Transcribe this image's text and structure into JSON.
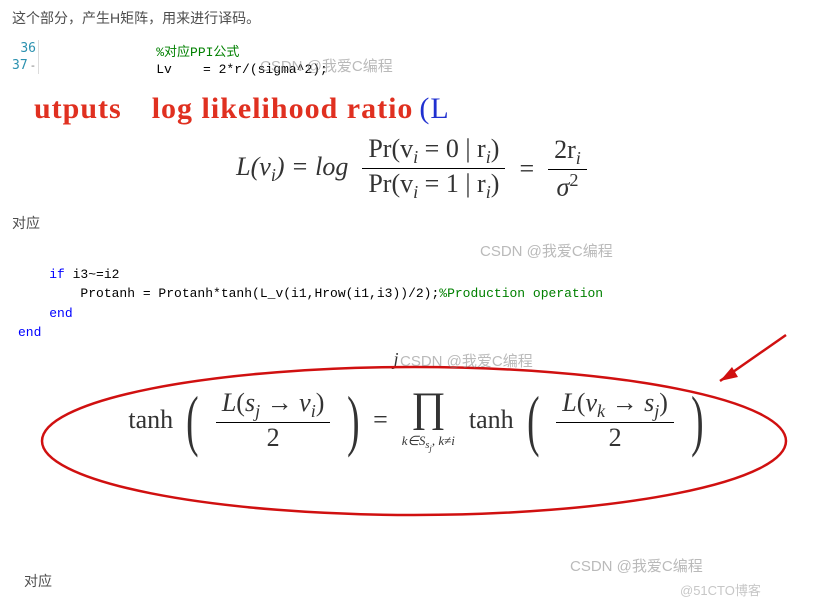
{
  "intro_text": "这个部分，产生H矩阵，用来进行译码。",
  "code1": {
    "linenos": [
      "36",
      "37"
    ],
    "fold_char": "-",
    "line1_comment": "%对应PPI公式",
    "line2": "Lv    = 2*r/(sigma^2);"
  },
  "red_row": {
    "word1": "utputs",
    "word2": "log likelihood ratio",
    "word3": "(L"
  },
  "formula1": {
    "lhs_pre": "L(v",
    "lhs_sub": "i",
    "lhs_post": ") = log",
    "num_pre": "Pr(v",
    "num_sub1": "i",
    "num_mid": " = 0 | r",
    "num_sub2": "i",
    "num_post": ")",
    "den_pre": "Pr(v",
    "den_sub1": "i",
    "den_mid": " = 1 | r",
    "den_sub2": "i",
    "den_post": ")",
    "eq": " = ",
    "r2_num_pre": "2r",
    "r2_num_sub": "i",
    "r2_den_pre": "σ",
    "r2_den_sup": "2"
  },
  "label_duiying": "对应",
  "code2": {
    "l1_kw": "if",
    "l1_rest": " i3~=i2",
    "l2_code": "        Protanh = Protanh*tanh(L_v(i1,Hrow(i1,i3))/2);",
    "l2_comment": "%Production operation",
    "l3_kw": "end",
    "l4_kw": "end"
  },
  "floating_j": "j",
  "formula2": {
    "tanh": "tanh",
    "f1_num": "L(s_j → v_i)",
    "f1_den": "2",
    "eq": "=",
    "prod_sub": "k∈S_{s_j}, k≠i",
    "f2_num": "L(v_k → s_j)",
    "f2_den": "2"
  },
  "watermarks": {
    "csdn": "CSDN @我爱C编程",
    "cto": "@51CTO博客"
  }
}
